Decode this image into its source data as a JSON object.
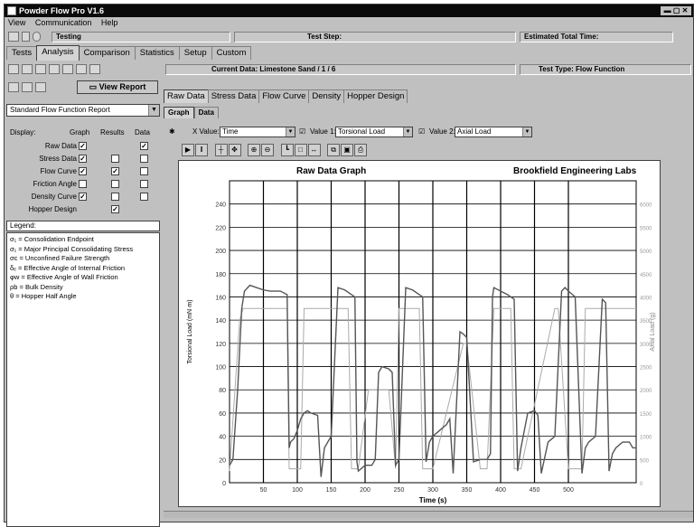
{
  "window": {
    "title": "Powder Flow Pro V1.6"
  },
  "menu": [
    "View",
    "Communication",
    "Help"
  ],
  "status": {
    "state": "Testing",
    "test_step_label": "Test Step:",
    "estimated_time_label": "Estimated Total Time:"
  },
  "main_tabs": [
    "Tests",
    "Analysis",
    "Comparison",
    "Statistics",
    "Setup",
    "Custom"
  ],
  "current_data": "Current Data: Limestone Sand / 1 / 6",
  "test_type": "Test Type: Flow Function",
  "view_report_label": "View Report",
  "report_select": "Standard Flow Function Report",
  "display_headers": {
    "display": "Display:",
    "graph": "Graph",
    "results": "Results",
    "data": "Data"
  },
  "display_rows": [
    {
      "label": "Raw Data",
      "graph": true,
      "results": null,
      "data": true
    },
    {
      "label": "Stress Data",
      "graph": true,
      "results": false,
      "data": false
    },
    {
      "label": "Flow Curve",
      "graph": true,
      "results": true,
      "data": false
    },
    {
      "label": "Friction Angle",
      "graph": false,
      "results": false,
      "data": false
    },
    {
      "label": "Density Curve",
      "graph": true,
      "results": false,
      "data": false
    },
    {
      "label": "Hopper Design",
      "graph": null,
      "results": true,
      "data": null
    }
  ],
  "legend_label": "Legend:",
  "legend": [
    "σ₁ = Consolidation Endpoint",
    "σ₁ = Major Principal Consolidating Stress",
    "σc = Unconfined Failure Strength",
    "δₑ = Effective Angle of Internal Friction",
    "φw = Effective Angle of Wall Friction",
    "ρb = Bulk Density",
    "θ = Hopper Half Angle"
  ],
  "sub_tabs": [
    "Raw Data",
    "Stress Data",
    "Flow Curve",
    "Density",
    "Hopper Design"
  ],
  "graph_tabs": [
    "Graph",
    "Data"
  ],
  "values": {
    "xvalue_label": "X Value:",
    "xvalue": "Time",
    "y1_label": "Value 1:",
    "y1": "Torsional Load",
    "y2_label": "Value 2:",
    "y2": "Axial Load"
  },
  "chart_data": {
    "type": "line",
    "title": "Raw Data Graph",
    "subtitle": "Brookfield Engineering Labs",
    "xlabel": "Time (s)",
    "ylabel": "Torsional Load (mN·m)",
    "y2label": "Axial Load (g)",
    "xlim": [
      0,
      600
    ],
    "ylim": [
      0,
      260
    ],
    "y2lim": [
      0,
      6500
    ],
    "xticks": [
      50,
      100,
      150,
      200,
      250,
      300,
      350,
      400,
      450,
      500
    ],
    "yticks": [
      0,
      20,
      40,
      60,
      80,
      100,
      120,
      140,
      160,
      180,
      200,
      220,
      240
    ],
    "y2ticks": [
      0,
      500,
      1000,
      1500,
      2000,
      2500,
      3000,
      3500,
      4000,
      4500,
      5000,
      5500,
      6000
    ],
    "y2tick_labels": [
      "0",
      "500",
      "1000",
      "1500",
      "2000",
      "2500",
      "3000",
      "3500",
      "4000",
      "4500",
      "5000",
      "5500",
      "6000"
    ],
    "grid": true,
    "series": [
      {
        "color": "#555555",
        "x": [
          0,
          5,
          12,
          18,
          22,
          30,
          40,
          50,
          60,
          75,
          85,
          88,
          90,
          95,
          100,
          105,
          110,
          115,
          120,
          130,
          135,
          140,
          145,
          150,
          160,
          170,
          180,
          185,
          188,
          190,
          200,
          210,
          215,
          220,
          225,
          235,
          240,
          245,
          250,
          260,
          270,
          280,
          285,
          290,
          295,
          300,
          310,
          320,
          325,
          330,
          340,
          345,
          350,
          360,
          370,
          380,
          385,
          388,
          390,
          400,
          410,
          415,
          420,
          425,
          430,
          440,
          450,
          455,
          460,
          470,
          480,
          490,
          495,
          500,
          510,
          520,
          525,
          530,
          540,
          550,
          555,
          560,
          565,
          570,
          580,
          590,
          595,
          600
        ],
        "y": [
          15,
          20,
          80,
          150,
          165,
          170,
          168,
          166,
          165,
          165,
          162,
          30,
          35,
          38,
          45,
          55,
          60,
          62,
          60,
          58,
          5,
          30,
          35,
          40,
          168,
          166,
          162,
          160,
          18,
          10,
          15,
          15,
          20,
          95,
          100,
          98,
          95,
          15,
          20,
          168,
          166,
          162,
          160,
          18,
          35,
          40,
          45,
          50,
          55,
          8,
          130,
          128,
          125,
          18,
          20,
          20,
          25,
          160,
          168,
          165,
          162,
          160,
          158,
          10,
          30,
          60,
          62,
          58,
          8,
          35,
          40,
          165,
          168,
          165,
          160,
          8,
          30,
          35,
          40,
          158,
          155,
          10,
          25,
          30,
          35,
          35,
          30,
          30
        ]
      },
      {
        "color": "#aaaaaa",
        "x": [
          0,
          8,
          15,
          20,
          85,
          88,
          105,
          110,
          175,
          180,
          190,
          205,
          235,
          245,
          250,
          280,
          285,
          300,
          345,
          350,
          370,
          380,
          390,
          415,
          420,
          430,
          480,
          485,
          500,
          520,
          525,
          590,
          600
        ],
        "y": [
          10,
          80,
          140,
          150,
          150,
          12,
          12,
          150,
          150,
          12,
          12,
          80,
          80,
          12,
          150,
          150,
          12,
          12,
          120,
          120,
          12,
          12,
          150,
          150,
          12,
          12,
          150,
          150,
          12,
          12,
          150,
          150,
          150
        ]
      }
    ]
  }
}
